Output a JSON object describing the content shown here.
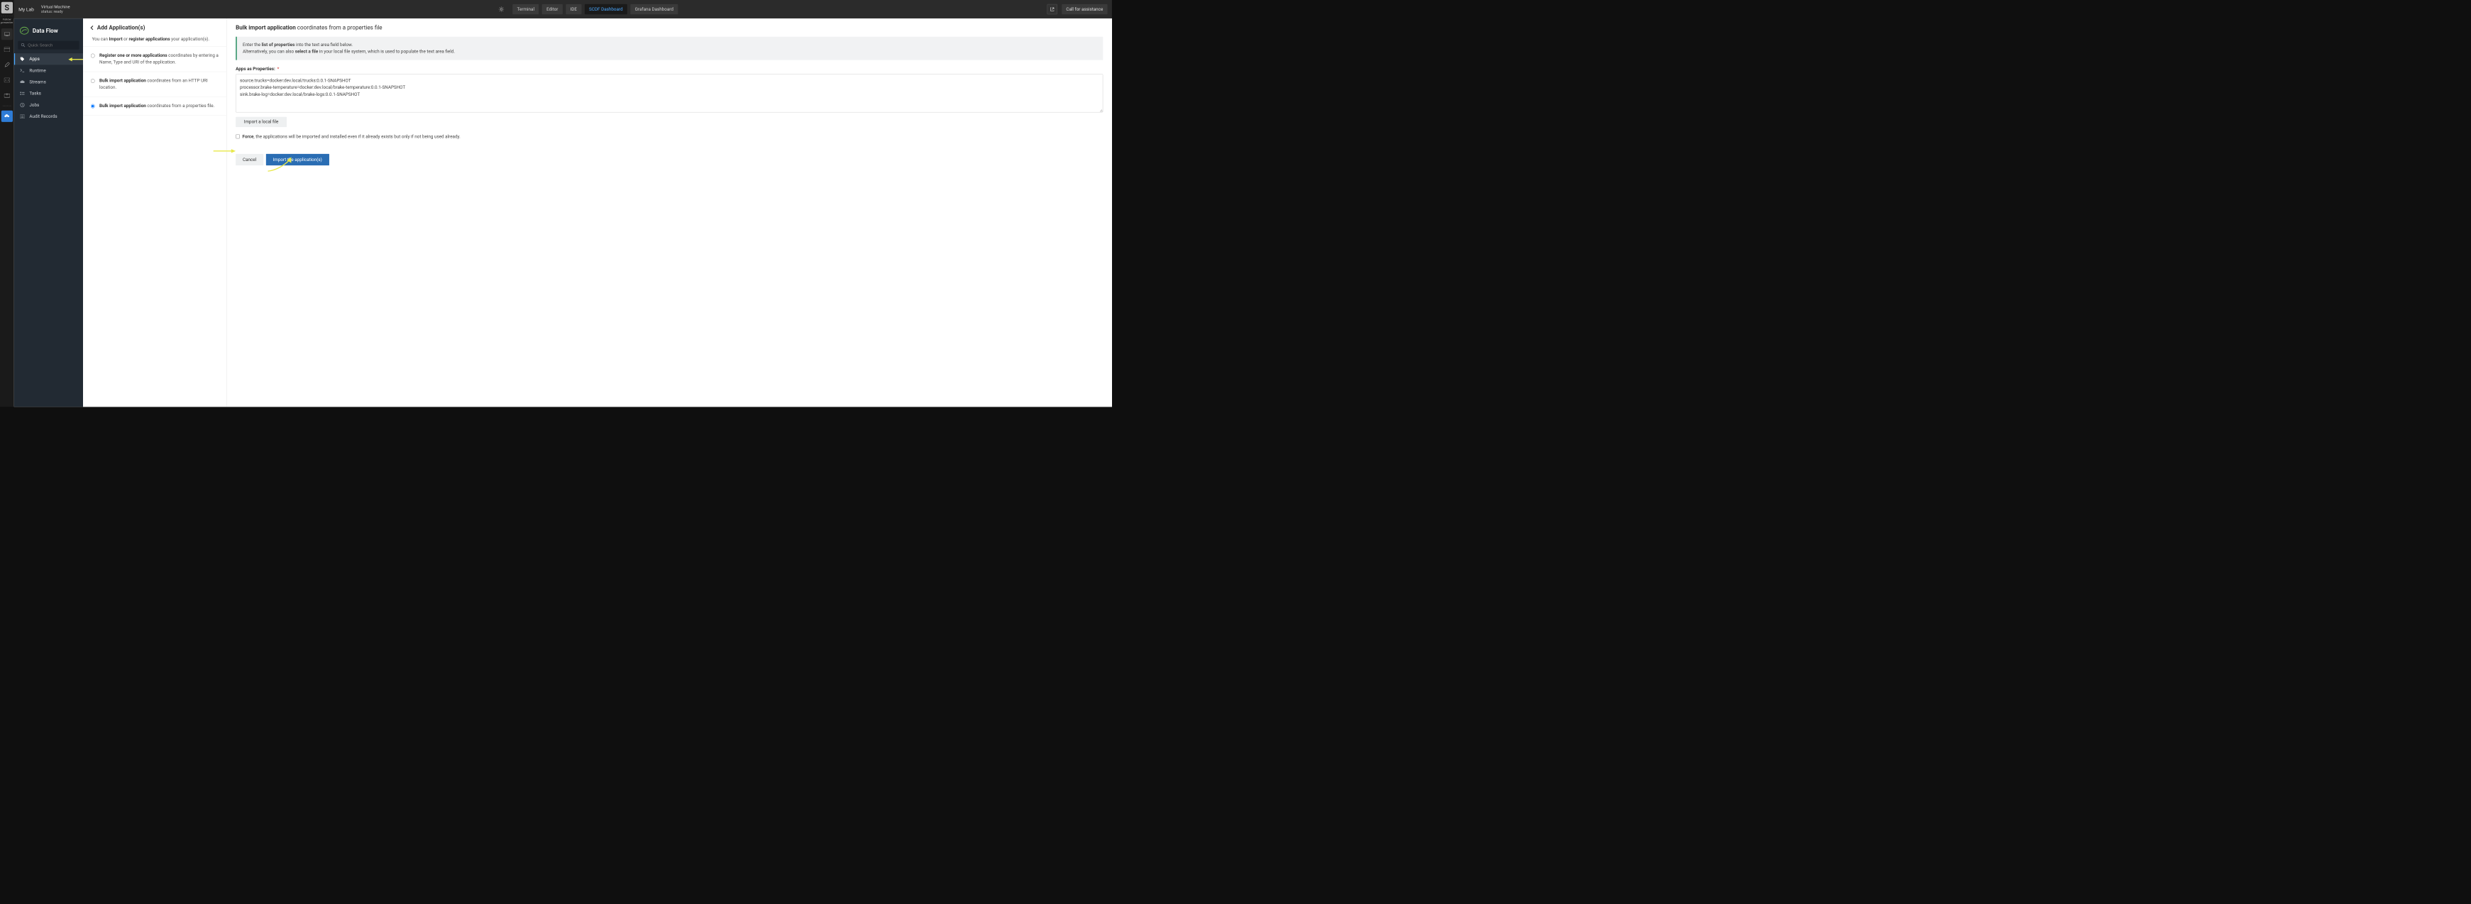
{
  "rail": {
    "logo": "S",
    "follow_line1": "Follow",
    "follow_line2": "presenter"
  },
  "topbar": {
    "lab_label": "My Lab",
    "vm_title": "Virtual Machine",
    "vm_status": "status: ready",
    "tabs": {
      "terminal": "Terminal",
      "editor": "Editor",
      "ide": "IDE",
      "scdf": "SCDF Dashboard",
      "grafana": "Grafana Dashboard"
    },
    "assist": "Call for assistance"
  },
  "df_sidebar": {
    "brand": "Data Flow",
    "search_placeholder": "Quick Search",
    "items": {
      "apps": "Apps",
      "runtime": "Runtime",
      "streams": "Streams",
      "tasks": "Tasks",
      "jobs": "Jobs",
      "audit": "Audit Records"
    }
  },
  "left_pane": {
    "title": "Add Application(s)",
    "sub_prefix": "You can ",
    "sub_import": "Import",
    "sub_or": " or ",
    "sub_register": "register applications",
    "sub_suffix": " your application(s).",
    "opt1_bold": "Register one or more applications",
    "opt1_rest": " coordinates by entering a Name, Type and URI of the application.",
    "opt2_bold": "Bulk import application",
    "opt2_rest": " coordinates from an HTTP URI location.",
    "opt3_bold": "Bulk import application",
    "opt3_rest": " coordinates from a properties file."
  },
  "right_pane": {
    "title_bold": "Bulk import application",
    "title_rest": " coordinates from a properties file",
    "info_l1_a": "Enter the ",
    "info_l1_b": "list of properties",
    "info_l1_c": " into the text area field below.",
    "info_l2_a": "Alternatively, you can also ",
    "info_l2_b": "select a file",
    "info_l2_c": " in your local file system, which is used to populate the text area field.",
    "props_label": "Apps as Properties:",
    "props_value": "source.trucks=docker:dev.local/trucks:0.0.1-SNAPSHOT\nprocessor.brake-temperature=docker:dev.local/brake-temperature:0.0.1-SNAPSHOT\nsink.brake-log=docker:dev.local/brake-logs:0.0.1-SNAPSHOT",
    "import_file": "Import a local file",
    "force_bold": "Force",
    "force_rest": ", the applications will be imported and installed even if it already exists but only if not being used already.",
    "cancel": "Cancel",
    "submit": "Import the application(s)"
  }
}
